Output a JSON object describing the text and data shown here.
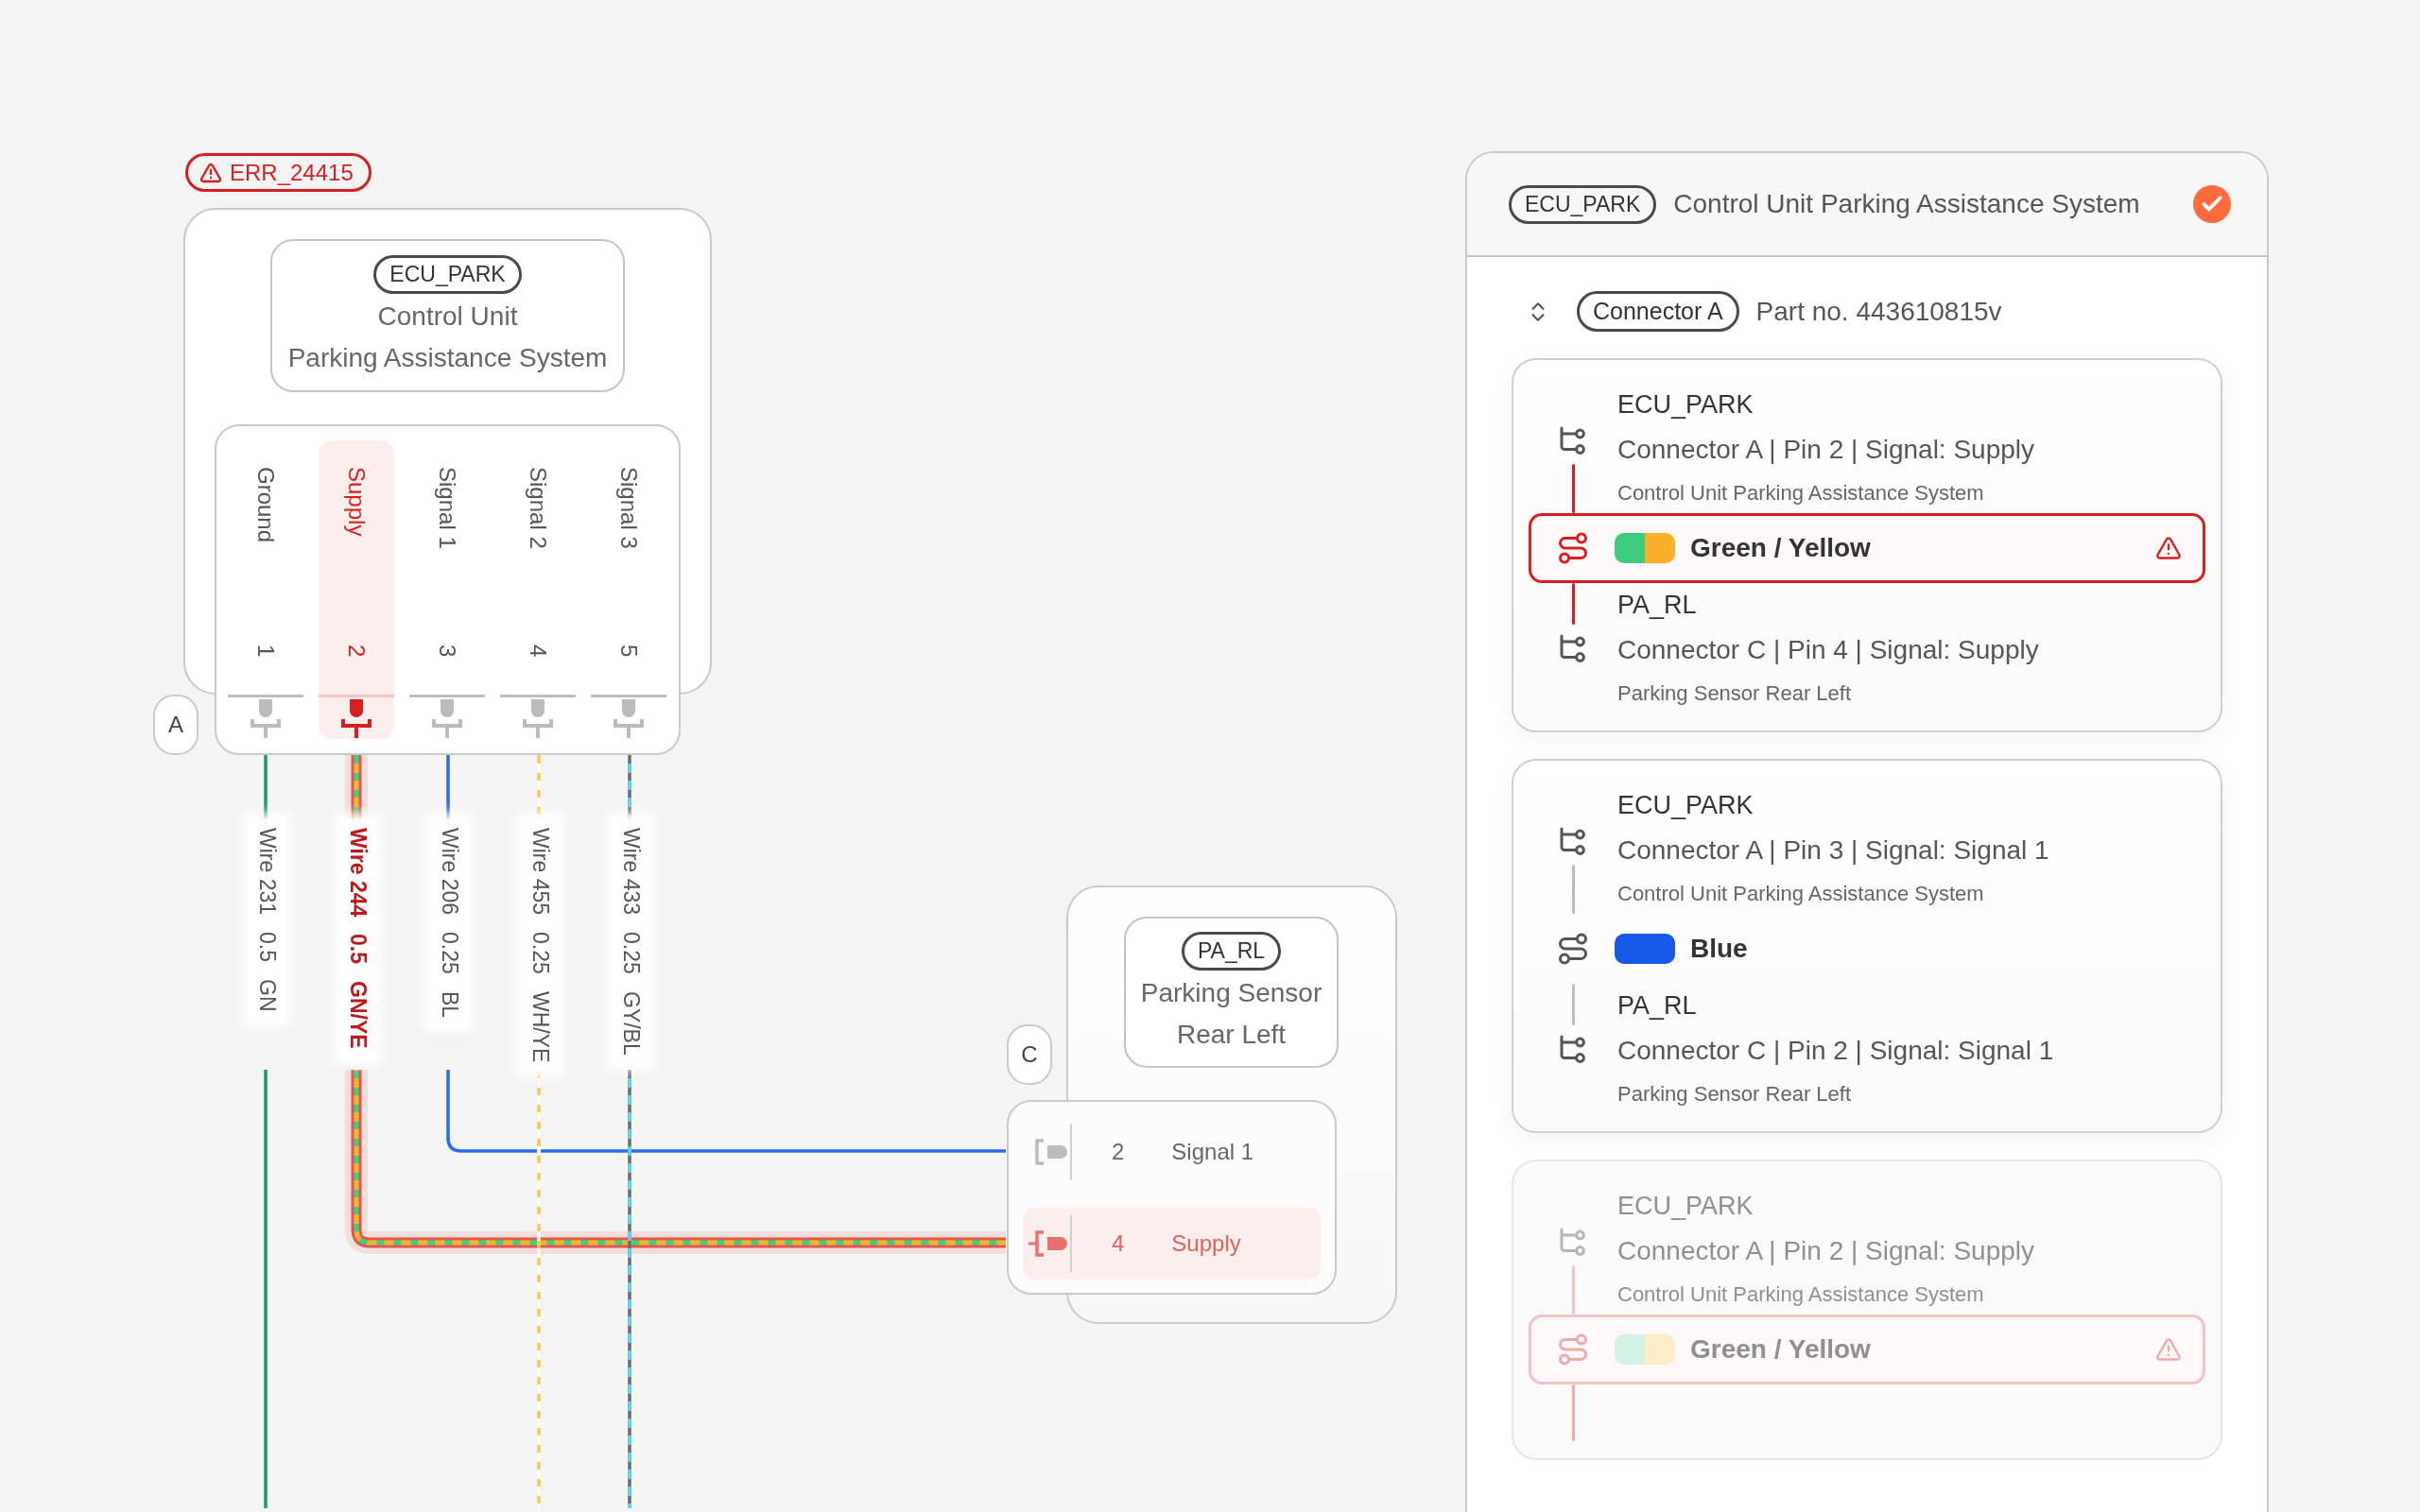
{
  "error_badge": {
    "label": "ERR_24415"
  },
  "diagram": {
    "components": [
      {
        "tag": "ECU_PARK",
        "lines": [
          "Control Unit",
          "Parking Assistance System"
        ],
        "connector": "A",
        "pins": [
          {
            "signal": "Ground",
            "number": "1",
            "selected": false
          },
          {
            "signal": "Supply",
            "number": "2",
            "selected": true
          },
          {
            "signal": "Signal 1",
            "number": "3",
            "selected": false
          },
          {
            "signal": "Signal 2",
            "number": "4",
            "selected": false
          },
          {
            "signal": "Signal 3",
            "number": "5",
            "selected": false
          }
        ]
      },
      {
        "tag": "PA_RL",
        "lines": [
          "Parking Sensor",
          "Rear Left"
        ],
        "connector": "C",
        "pins": [
          {
            "number": "2",
            "signal": "Signal 1",
            "selected": false
          },
          {
            "number": "4",
            "signal": "Supply",
            "selected": true
          }
        ]
      }
    ],
    "wires": [
      {
        "label": "Wire 231",
        "gauge": "0.5",
        "code": "GN",
        "colors": [
          {
            "color": "#1e9c5c"
          }
        ],
        "selected": false
      },
      {
        "label": "Wire 244",
        "gauge": "0.5",
        "code": "GN/YE",
        "colors": [
          {
            "color": "#3ecf7f"
          },
          {
            "color": "#fbb02c"
          }
        ],
        "selected": true
      },
      {
        "label": "Wire 206",
        "gauge": "0.25",
        "code": "BL",
        "colors": [
          {
            "color": "#2f6be8"
          }
        ],
        "selected": false
      },
      {
        "label": "Wire 455",
        "gauge": "0.25",
        "code": "WH/YE",
        "colors": [
          {
            "color": "#f8c945"
          },
          {
            "color": "#ffffff"
          }
        ],
        "selected": false
      },
      {
        "label": "Wire 433",
        "gauge": "0.25",
        "code": "GY/BL",
        "colors": [
          {
            "color": "#6b6b6b"
          },
          {
            "color": "#62d6ef"
          }
        ],
        "selected": false
      }
    ]
  },
  "panel": {
    "tag": "ECU_PARK",
    "title": "Control Unit Parking Assistance System",
    "verified": true,
    "connector": "Connector A",
    "part_no": "Part no. 443610815v",
    "connections": [
      {
        "from": {
          "name": "ECU_PARK",
          "detail": "Connector A | Pin 2 | Signal: Supply",
          "description": "Control Unit Parking Assistance System"
        },
        "wire": {
          "label": "Green / Yellow",
          "error": true,
          "swatch": [
            {
              "color": "#3fcb7e"
            },
            {
              "color": "#fbb02c"
            }
          ]
        },
        "to": {
          "name": "PA_RL",
          "detail": "Connector C | Pin 4 | Signal: Supply",
          "description": "Parking Sensor Rear Left"
        }
      },
      {
        "from": {
          "name": "ECU_PARK",
          "detail": "Connector A | Pin 3 | Signal: Signal 1",
          "description": "Control Unit Parking Assistance System"
        },
        "wire": {
          "label": "Blue",
          "error": false,
          "swatch": [
            {
              "color": "#1659e8"
            }
          ]
        },
        "to": {
          "name": "PA_RL",
          "detail": "Connector C | Pin 2 | Signal: Signal 1",
          "description": "Parking Sensor Rear Left"
        }
      },
      {
        "dimmed": true,
        "from": {
          "name": "ECU_PARK",
          "detail": "Connector A | Pin 2 | Signal: Supply",
          "description": "Control Unit Parking Assistance System"
        },
        "wire": {
          "label": "Green / Yellow",
          "error": true,
          "swatch": [
            {
              "color": "#d3f1e1"
            },
            {
              "color": "#fcecc9"
            }
          ]
        }
      }
    ]
  }
}
